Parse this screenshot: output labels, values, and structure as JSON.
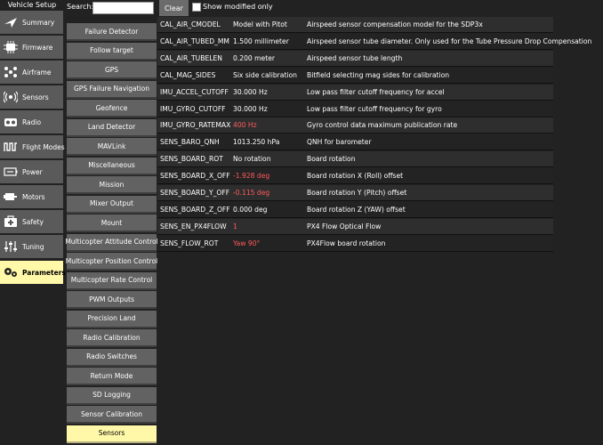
{
  "nav": {
    "title": "Vehicle Setup",
    "items": [
      {
        "label": "Summary",
        "icon": "summary-icon"
      },
      {
        "label": "Firmware",
        "icon": "firmware-icon"
      },
      {
        "label": "Airframe",
        "icon": "airframe-icon"
      },
      {
        "label": "Sensors",
        "icon": "sensors-icon"
      },
      {
        "label": "Radio",
        "icon": "radio-icon"
      },
      {
        "label": "Flight Modes",
        "icon": "flight-modes-icon"
      },
      {
        "label": "Power",
        "icon": "power-icon"
      },
      {
        "label": "Motors",
        "icon": "motors-icon"
      },
      {
        "label": "Safety",
        "icon": "safety-icon"
      },
      {
        "label": "Tuning",
        "icon": "tuning-icon"
      },
      {
        "label": "Parameters",
        "icon": "parameters-icon",
        "active": true
      }
    ]
  },
  "search": {
    "label": "Search:",
    "value": "",
    "clear_label": "Clear",
    "modified_only_label": "Show modified only"
  },
  "groups": [
    "Failure Detector",
    "Follow target",
    "GPS",
    "GPS Failure Navigation",
    "Geofence",
    "Land Detector",
    "MAVLink",
    "Miscellaneous",
    "Mission",
    "Mixer Output",
    "Mount",
    "Multicopter Attitude Control",
    "Multicopter Position Control",
    "Multicopter Rate Control",
    "PWM Outputs",
    "Precision Land",
    "Radio Calibration",
    "Radio Switches",
    "Return Mode",
    "SD Logging",
    "Sensor Calibration",
    "Sensors"
  ],
  "active_group": "Sensors",
  "params": [
    {
      "name": "CAL_AIR_CMODEL",
      "value": "Model with Pitot",
      "desc": "Airspeed sensor compensation model for the SDP3x",
      "modified": false
    },
    {
      "name": "CAL_AIR_TUBED_MM",
      "value": "1.500 millimeter",
      "desc": "Airspeed sensor tube diameter. Only used for the Tube Pressure Drop Compensation",
      "modified": false
    },
    {
      "name": "CAL_AIR_TUBELEN",
      "value": "0.200 meter",
      "desc": "Airspeed sensor tube length",
      "modified": false
    },
    {
      "name": "CAL_MAG_SIDES",
      "value": "Six side calibration",
      "desc": "Bitfield selecting mag sides for calibration",
      "modified": false
    },
    {
      "name": "IMU_ACCEL_CUTOFF",
      "value": "30.000 Hz",
      "desc": "Low pass filter cutoff frequency for accel",
      "modified": false
    },
    {
      "name": "IMU_GYRO_CUTOFF",
      "value": "30.000 Hz",
      "desc": "Low pass filter cutoff frequency for gyro",
      "modified": false
    },
    {
      "name": "IMU_GYRO_RATEMAX",
      "value": "400 Hz",
      "desc": "Gyro control data maximum publication rate",
      "modified": true
    },
    {
      "name": "SENS_BARO_QNH",
      "value": "1013.250 hPa",
      "desc": "QNH for barometer",
      "modified": false
    },
    {
      "name": "SENS_BOARD_ROT",
      "value": "No rotation",
      "desc": "Board rotation",
      "modified": false
    },
    {
      "name": "SENS_BOARD_X_OFF",
      "value": "-1.928 deg",
      "desc": "Board rotation X (Roll) offset",
      "modified": true
    },
    {
      "name": "SENS_BOARD_Y_OFF",
      "value": "-0.115 deg",
      "desc": "Board rotation Y (Pitch) offset",
      "modified": true
    },
    {
      "name": "SENS_BOARD_Z_OFF",
      "value": "0.000 deg",
      "desc": "Board rotation Z (YAW) offset",
      "modified": false
    },
    {
      "name": "SENS_EN_PX4FLOW",
      "value": "1",
      "desc": "PX4 Flow Optical Flow",
      "modified": true
    },
    {
      "name": "SENS_FLOW_ROT",
      "value": "Yaw 90°",
      "desc": "PX4Flow board rotation",
      "modified": true
    }
  ],
  "colors": {
    "background": "#222222",
    "button": "#626262",
    "active": "#fff8a8",
    "modified_value": "#ff5a5a"
  }
}
